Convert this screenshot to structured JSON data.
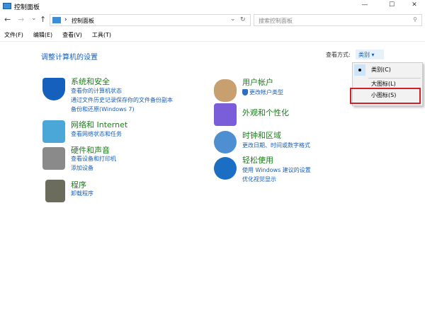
{
  "window": {
    "title": "控制面板",
    "minimize": "—",
    "maximize": "☐",
    "close": "✕"
  },
  "nav": {
    "back": "←",
    "forward": "→",
    "recent": "⌄",
    "up": "↑",
    "breadcrumb": "控制面板",
    "separator": "›",
    "dropdown": "⌄",
    "refresh": "↻",
    "search_placeholder": "搜索控制面板",
    "search_icon": "⚲"
  },
  "menu": [
    "文件(F)",
    "编辑(E)",
    "查看(V)",
    "工具(T)"
  ],
  "heading": "调整计算机的设置",
  "view": {
    "label": "查看方式:",
    "value": "类别",
    "arrow": "▾",
    "options": [
      "类别(C)",
      "大图标(L)",
      "小图标(S)"
    ],
    "selected": "类别(C)",
    "highlighted": "小图标(S)",
    "highlight_color": "#d0202a"
  },
  "left": [
    {
      "title": "系统和安全",
      "links": [
        "查看你的计算机状态",
        "通过文件历史记录保存你的文件备份副本",
        "备份和还原(Windows 7)"
      ]
    },
    {
      "title": "网络和 Internet",
      "links": [
        "查看网络状态和任务"
      ]
    },
    {
      "title": "硬件和声音",
      "links": [
        "查看设备和打印机",
        "添加设备"
      ]
    },
    {
      "title": "程序",
      "links": [
        "卸载程序"
      ]
    }
  ],
  "right": [
    {
      "title": "用户帐户",
      "links": [
        "更改帐户类型"
      ]
    },
    {
      "title": "外观和个性化",
      "links": []
    },
    {
      "title": "时钟和区域",
      "links": [
        "更改日期、时间或数字格式"
      ]
    },
    {
      "title": "轻松使用",
      "links": [
        "使用 Windows 建议的设置",
        "优化视觉显示"
      ]
    }
  ]
}
